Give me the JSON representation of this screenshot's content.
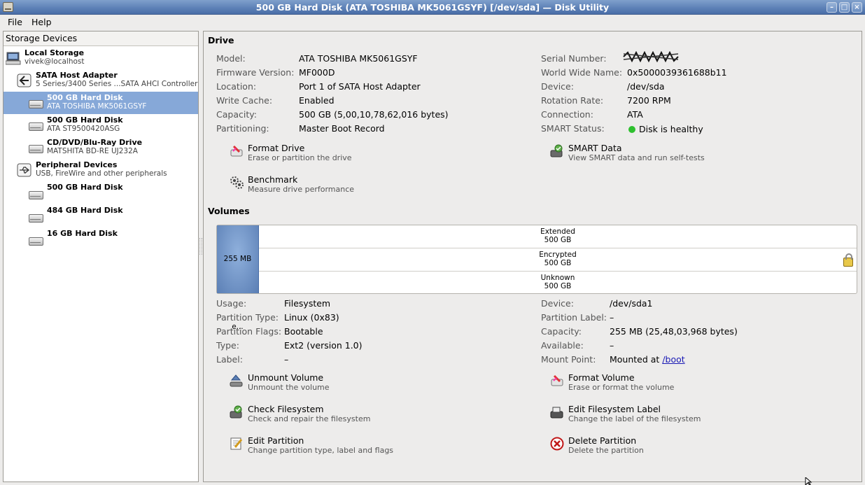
{
  "window": {
    "title": "500 GB Hard Disk (ATA TOSHIBA MK5061GSYF) [/dev/sda] — Disk Utility"
  },
  "menu": {
    "file": "File",
    "help": "Help"
  },
  "sidebar": {
    "header": "Storage Devices",
    "items": [
      {
        "title": "Local Storage",
        "subtitle": "vivek@localhost",
        "icon": "computer-icon"
      },
      {
        "title": "SATA Host Adapter",
        "subtitle": "5 Series/3400 Series ...SATA AHCI Controller",
        "icon": "host-adapter-icon"
      },
      {
        "title": "500 GB Hard Disk",
        "subtitle": "ATA TOSHIBA MK5061GSYF",
        "icon": "hard-disk-icon",
        "selected": true
      },
      {
        "title": "500 GB Hard Disk",
        "subtitle": "ATA ST9500420ASG",
        "icon": "hard-disk-icon"
      },
      {
        "title": "CD/DVD/Blu-Ray Drive",
        "subtitle": "MATSHITA BD-RE UJ232A",
        "icon": "optical-drive-icon"
      },
      {
        "title": "Peripheral Devices",
        "subtitle": "USB, FireWire and other peripherals",
        "icon": "usb-icon"
      },
      {
        "title": "500 GB Hard Disk",
        "subtitle": "",
        "icon": "hard-disk-icon"
      },
      {
        "title": "484 GB Hard Disk",
        "subtitle": "",
        "icon": "hard-disk-icon"
      },
      {
        "title": "16 GB Hard Disk",
        "subtitle": "",
        "icon": "hard-disk-icon"
      }
    ]
  },
  "drive": {
    "section_title": "Drive",
    "left": [
      {
        "label": "Model:",
        "value": "ATA TOSHIBA MK5061GSYF"
      },
      {
        "label": "Firmware Version:",
        "value": "MF000D"
      },
      {
        "label": "Location:",
        "value": "Port 1 of SATA Host Adapter"
      },
      {
        "label": "Write Cache:",
        "value": "Enabled"
      },
      {
        "label": "Capacity:",
        "value": "500 GB (5,00,10,78,62,016 bytes)"
      },
      {
        "label": "Partitioning:",
        "value": "Master Boot Record"
      }
    ],
    "right": [
      {
        "label": "Serial Number:",
        "value": ""
      },
      {
        "label": "World Wide Name:",
        "value": "0x5000039361688b11"
      },
      {
        "label": "Device:",
        "value": "/dev/sda"
      },
      {
        "label": "Rotation Rate:",
        "value": "7200 RPM"
      },
      {
        "label": "Connection:",
        "value": "ATA"
      },
      {
        "label": "SMART Status:",
        "value": "Disk is healthy"
      }
    ],
    "actions": {
      "format": {
        "name": "Format Drive",
        "desc": "Erase or partition the drive"
      },
      "smart": {
        "name": "SMART Data",
        "desc": "View SMART data and run self-tests"
      },
      "benchmark": {
        "name": "Benchmark",
        "desc": "Measure drive performance"
      }
    }
  },
  "volumes": {
    "section_title": "Volumes",
    "first_partition": "255 MB e...",
    "rows": [
      {
        "name": "Extended",
        "size": "500 GB"
      },
      {
        "name": "Encrypted",
        "size": "500 GB"
      },
      {
        "name": "Unknown",
        "size": "500 GB"
      }
    ],
    "left": [
      {
        "label": "Usage:",
        "value": "Filesystem"
      },
      {
        "label": "Partition Type:",
        "value": "Linux (0x83)"
      },
      {
        "label": "Partition Flags:",
        "value": "Bootable"
      },
      {
        "label": "Type:",
        "value": "Ext2 (version 1.0)"
      },
      {
        "label": "Label:",
        "value": "–"
      }
    ],
    "right": [
      {
        "label": "Device:",
        "value": "/dev/sda1"
      },
      {
        "label": "Partition Label:",
        "value": "–"
      },
      {
        "label": "Capacity:",
        "value": "255 MB (25,48,03,968 bytes)"
      },
      {
        "label": "Available:",
        "value": "–"
      },
      {
        "label": "Mount Point:",
        "value": "Mounted at",
        "link": "/boot"
      }
    ],
    "actions": {
      "unmount": {
        "name": "Unmount Volume",
        "desc": "Unmount the volume"
      },
      "format": {
        "name": "Format Volume",
        "desc": "Erase or format the volume"
      },
      "check": {
        "name": "Check Filesystem",
        "desc": "Check and repair the filesystem"
      },
      "label": {
        "name": "Edit Filesystem Label",
        "desc": "Change the label of the filesystem"
      },
      "edit": {
        "name": "Edit Partition",
        "desc": "Change partition type, label and flags"
      },
      "delete": {
        "name": "Delete Partition",
        "desc": "Delete the partition"
      }
    }
  },
  "colors": {
    "selection": "#86a8d8",
    "titlebar": "#5b7fb5",
    "healthy": "#2ec02e",
    "link": "#1a1ab5"
  }
}
